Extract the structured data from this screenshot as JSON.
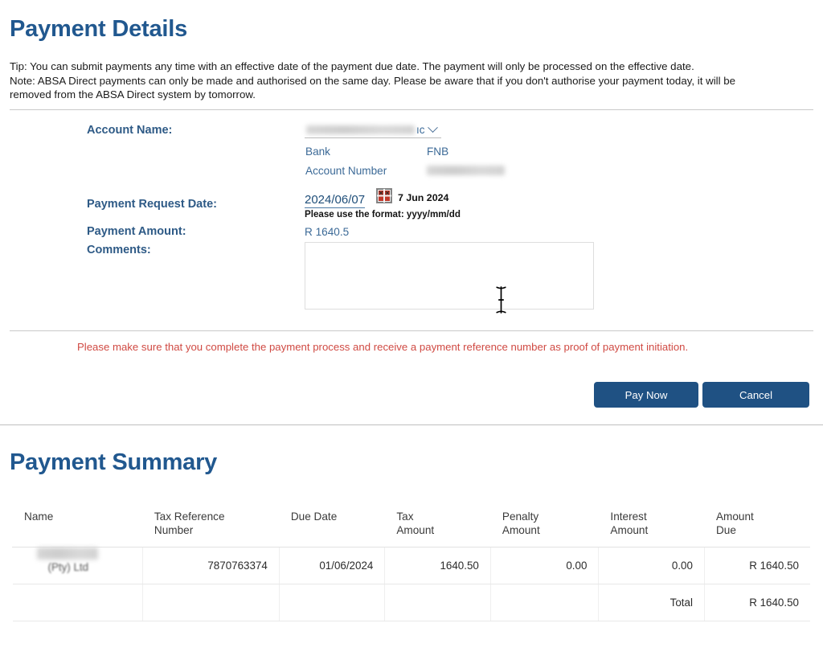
{
  "page": {
    "details_title": "Payment Details",
    "summary_title": "Payment Summary"
  },
  "notes": {
    "tip": "Tip: You can submit payments any time with an effective date of the payment due date. The payment will only be processed on the effective date.",
    "note_line1": "Note: ABSA Direct payments can only be made and authorised on the same day. Please be aware that if you don't authorise your payment today, it will be",
    "note_line2": "removed from the ABSA Direct system by tomorrow."
  },
  "form": {
    "account_name_label": "Account Name:",
    "account_name_value_tail": "ıc",
    "bank_key": "Bank",
    "bank_value": "FNB",
    "account_number_key": "Account Number",
    "account_number_value": "",
    "request_date_label": "Payment Request Date:",
    "request_date_value": "2024/06/07",
    "request_date_readable": "7 Jun 2024",
    "date_format_hint": "Please use the format: yyyy/mm/dd",
    "payment_amount_label": "Payment Amount:",
    "payment_amount_value": "R 1640.5",
    "comments_label": "Comments:",
    "comments_value": "",
    "comments_placeholder": ""
  },
  "warning": "Please make sure that you complete the payment process and receive a payment reference number as proof of payment initiation.",
  "actions": {
    "pay_now_label": "Pay Now",
    "cancel_label": "Cancel"
  },
  "summary": {
    "headers": {
      "name": "Name",
      "tax_reference_number": "Tax Reference\nNumber",
      "tax_reference_number_l1": "Tax Reference",
      "tax_reference_number_l2": "Number",
      "due_date": "Due Date",
      "tax_amount_l1": "Tax",
      "tax_amount_l2": "Amount",
      "penalty_amount_l1": "Penalty",
      "penalty_amount_l2": "Amount",
      "interest_amount_l1": "Interest",
      "interest_amount_l2": "Amount",
      "amount_due_l1": "Amount",
      "amount_due_l2": "Due"
    },
    "rows": [
      {
        "name_suffix": "(Pty) Ltd",
        "tax_reference_number": "7870763374",
        "due_date": "01/06/2024",
        "tax_amount": "1640.50",
        "penalty_amount": "0.00",
        "interest_amount": "0.00",
        "amount_due": "R 1640.50"
      }
    ],
    "total_label": "Total",
    "total_value": "R 1640.50"
  },
  "colors": {
    "heading_blue": "#21588f",
    "label_blue": "#2e5a86",
    "value_blue": "#3c6a97",
    "warning_red": "#d04a43",
    "button_blue": "#1f5183"
  }
}
